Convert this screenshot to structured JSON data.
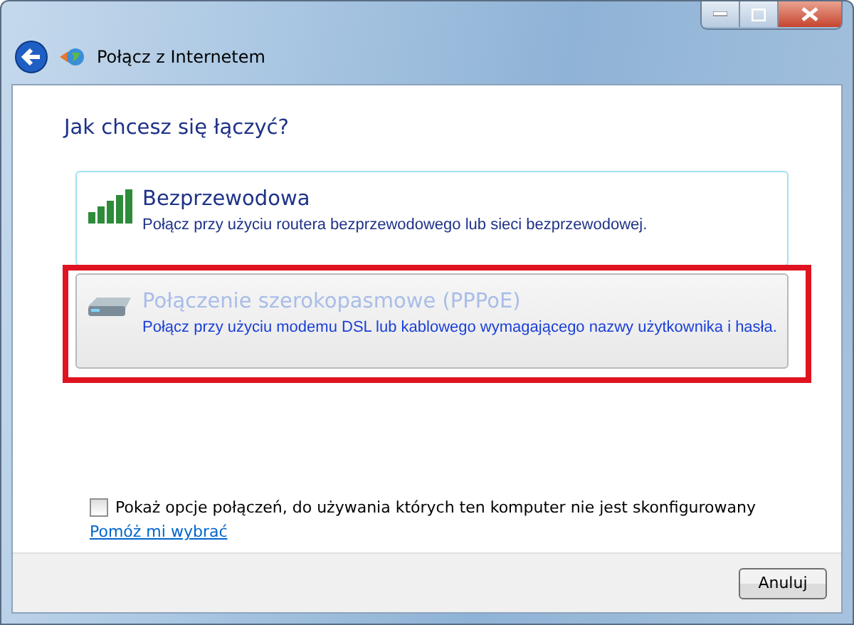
{
  "window": {
    "title": "Połącz z Internetem"
  },
  "heading": "Jak chcesz się łączyć?",
  "options": [
    {
      "kind": "wireless",
      "title": "Bezprzewodowa",
      "description": "Połącz przy użyciu routera bezprzewodowego lub sieci bezprzewodowej.",
      "focused": true,
      "selected": false,
      "highlighted": false
    },
    {
      "kind": "broadband",
      "title": "Połączenie szerokopasmowe (PPPoE)",
      "description": "Połącz przy użyciu modemu DSL lub kablowego wymagającego nazwy użytkownika i hasła.",
      "focused": false,
      "selected": true,
      "highlighted": true
    }
  ],
  "checkbox": {
    "label": "Pokaż opcje połączeń, do używania których ten komputer nie jest skonfigurowany",
    "checked": false
  },
  "help_link": "Pomóż mi wybrać",
  "buttons": [
    "Anuluj"
  ]
}
